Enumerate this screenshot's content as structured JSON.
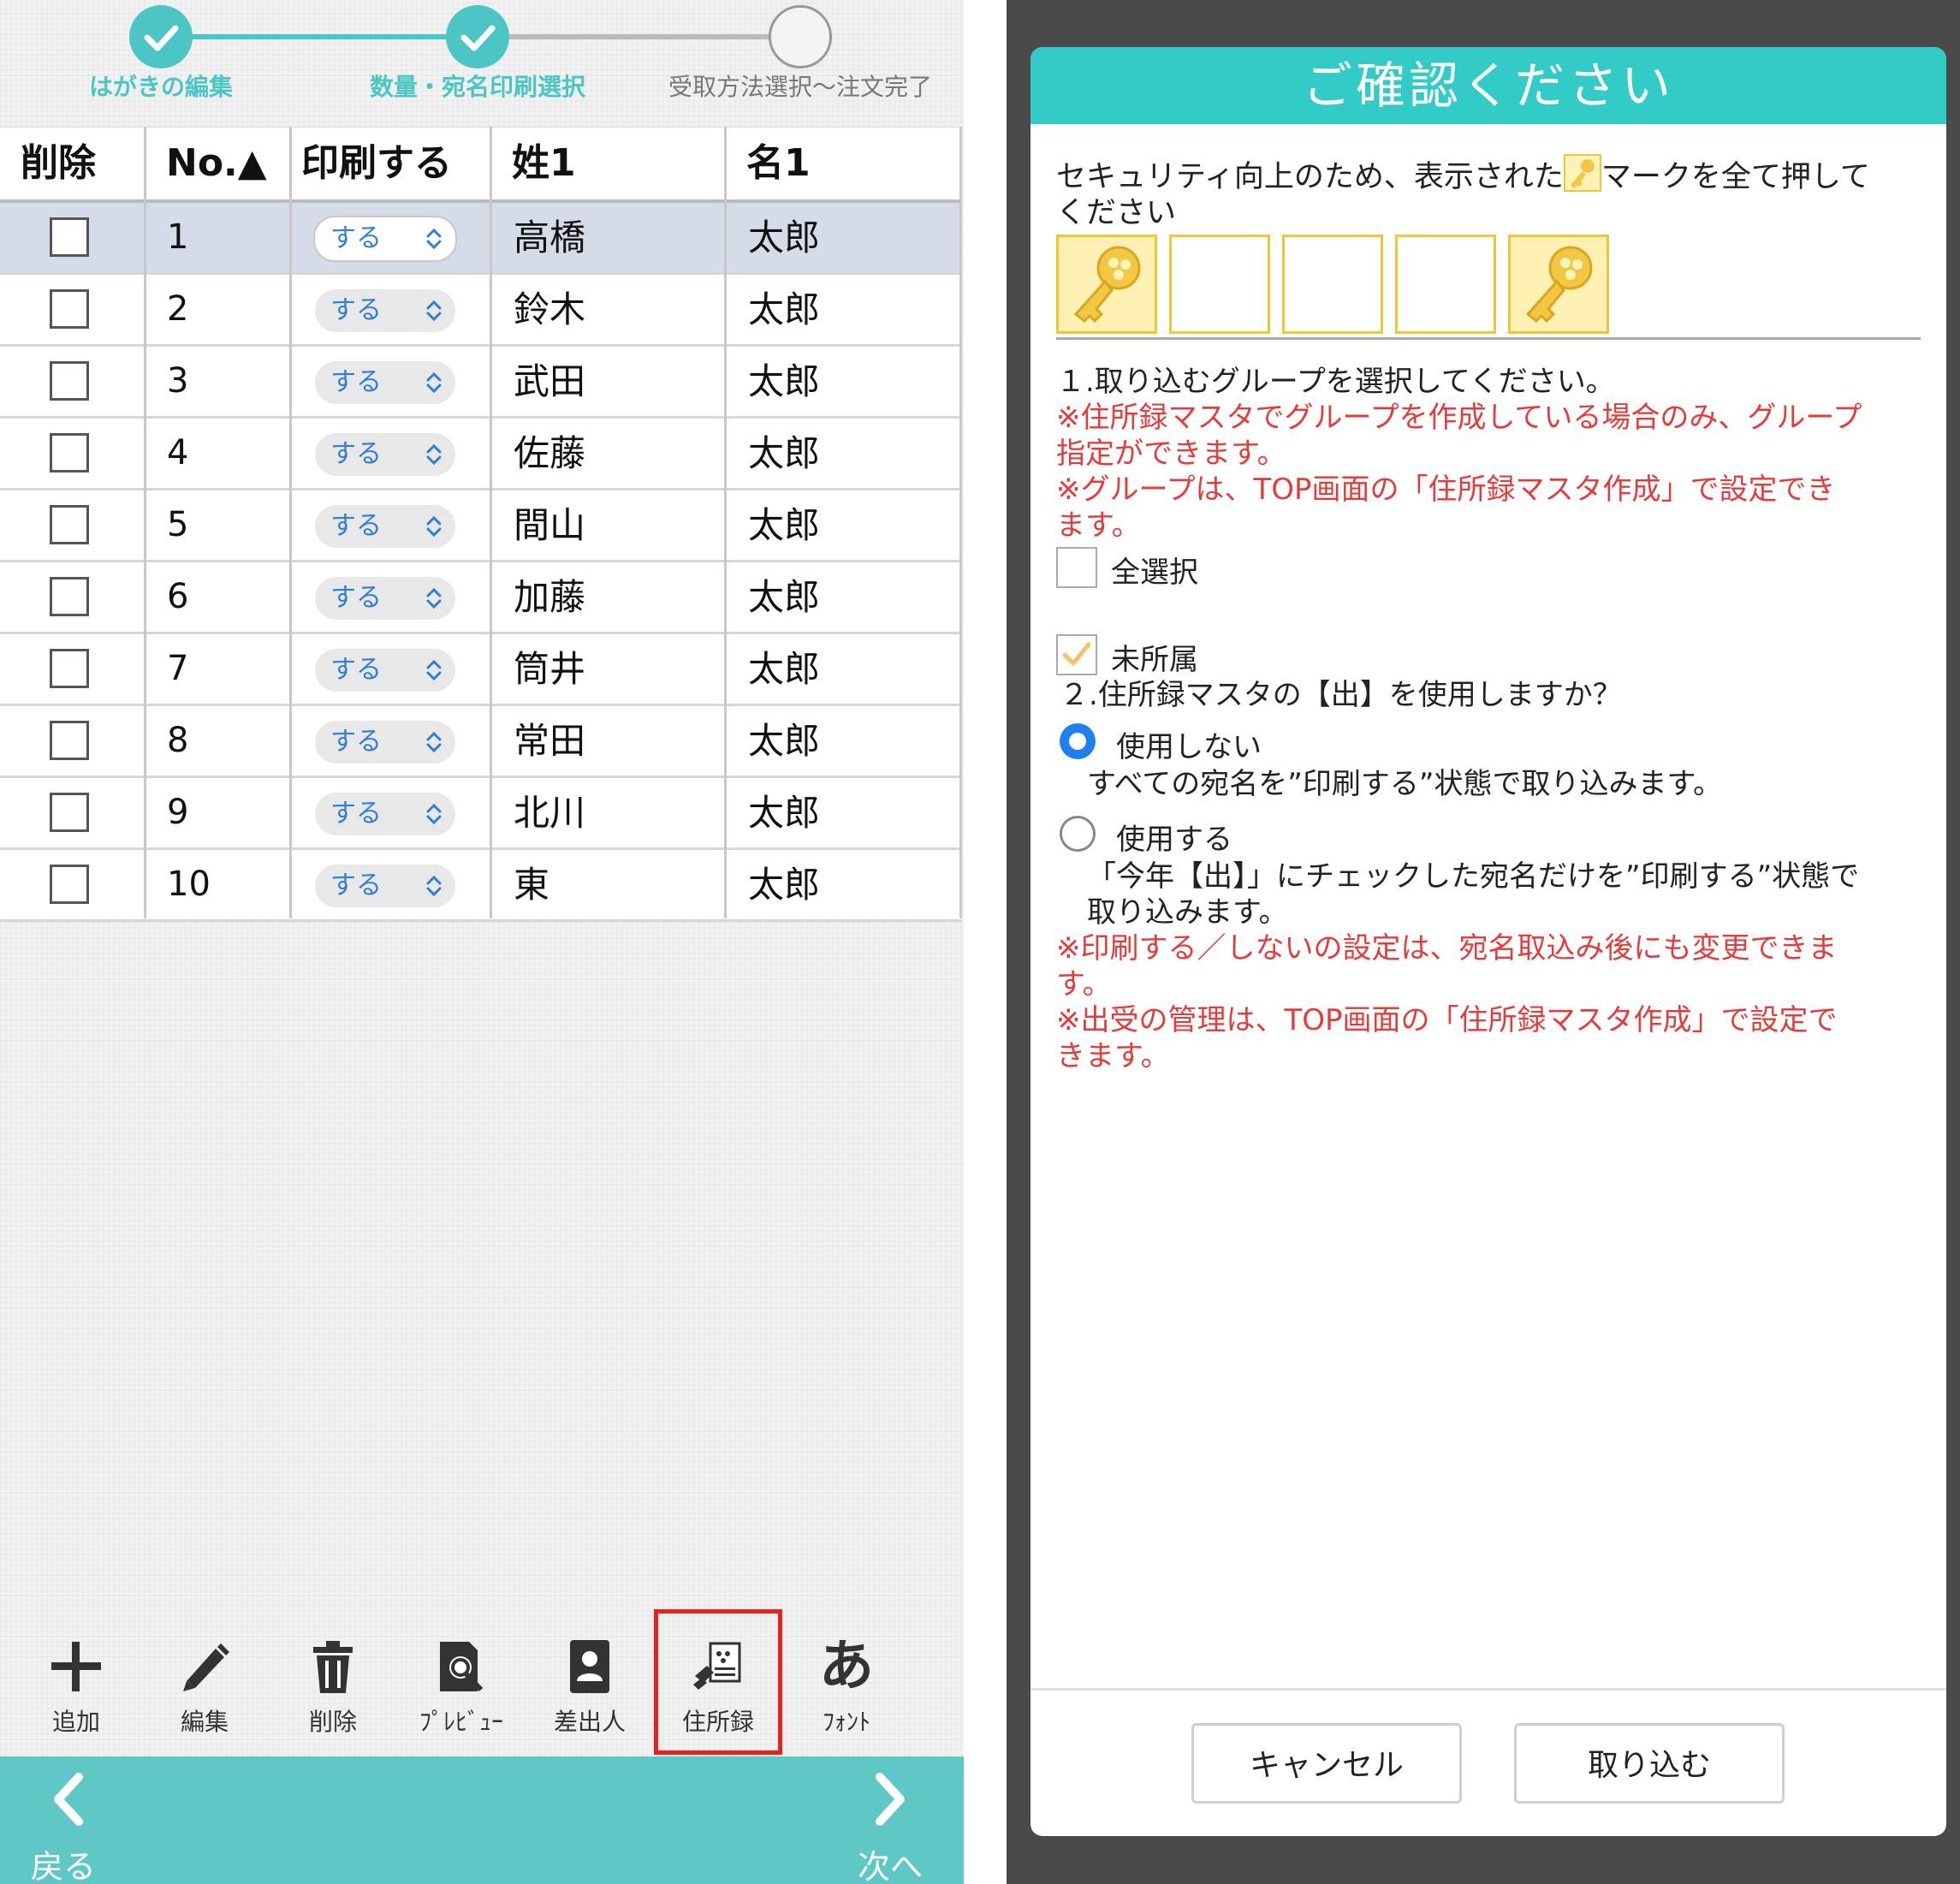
{
  "progress": {
    "steps": [
      {
        "label": "はがきの編集",
        "state": "done"
      },
      {
        "label": "数量・宛名印刷選択",
        "state": "done"
      },
      {
        "label": "受取方法選択〜注文完了",
        "state": "todo"
      }
    ]
  },
  "table": {
    "headers": {
      "delete": "削除",
      "no": "No.▲",
      "print": "印刷する",
      "sei": "姓1",
      "mei": "名1"
    },
    "rows": [
      {
        "no": "1",
        "print": "する",
        "sei": "高橋",
        "mei": "太郎"
      },
      {
        "no": "2",
        "print": "する",
        "sei": "鈴木",
        "mei": "太郎"
      },
      {
        "no": "3",
        "print": "する",
        "sei": "武田",
        "mei": "太郎"
      },
      {
        "no": "4",
        "print": "する",
        "sei": "佐藤",
        "mei": "太郎"
      },
      {
        "no": "5",
        "print": "する",
        "sei": "間山",
        "mei": "太郎"
      },
      {
        "no": "6",
        "print": "する",
        "sei": "加藤",
        "mei": "太郎"
      },
      {
        "no": "7",
        "print": "する",
        "sei": "筒井",
        "mei": "太郎"
      },
      {
        "no": "8",
        "print": "する",
        "sei": "常田",
        "mei": "太郎"
      },
      {
        "no": "9",
        "print": "する",
        "sei": "北川",
        "mei": "太郎"
      },
      {
        "no": "10",
        "print": "する",
        "sei": "東",
        "mei": "太郎"
      }
    ]
  },
  "toolbar": {
    "add": "追加",
    "edit": "編集",
    "delete": "削除",
    "preview": "ﾌﾟﾚﾋﾞｭｰ",
    "sender": "差出人",
    "address_book": "住所録",
    "font": "ﾌｫﾝﾄ",
    "font_glyph": "あ"
  },
  "footer": {
    "back": "戻る",
    "next": "次へ"
  },
  "modal": {
    "title": "ご確認ください",
    "security_before": "セキュリティ向上のため、表示された",
    "security_after": "マークを全て押して",
    "security_line2": "ください",
    "key_boxes": [
      true,
      false,
      false,
      false,
      true
    ],
    "q1": "１.取り込むグループを選択してください。",
    "note1a": "※住所録マスタでグループを作成している場合のみ、グループ",
    "note1b": "指定ができます。",
    "note2a": "※グループは、TOP画面の「住所録マスタ作成」で設定でき",
    "note2b": "ます。",
    "select_all": "全選択",
    "unassigned": "未所属",
    "q2": "２.住所録マスタの【出】を使用しますか？",
    "opt_no": "使用しない",
    "opt_no_desc": "すべての宛名を”印刷する”状態で取り込みます。",
    "opt_yes": "使用する",
    "opt_yes_desc1": "「今年【出】」にチェックした宛名だけを”印刷する”状態で",
    "opt_yes_desc2": "取り込みます。",
    "note3a": "※印刷する／しないの設定は、宛名取込み後にも変更できま",
    "note3b": "す。",
    "note4a": "※出受の管理は、TOP画面の「住所録マスタ作成」で設定で",
    "note4b": "きます。",
    "cancel": "キャンセル",
    "import": "取り込む"
  },
  "colors": {
    "accent": "#4cc6c4",
    "modal_header": "#33cbc8",
    "warning_red": "#e23c3c",
    "radio_blue": "#1e7ff0",
    "highlight_red": "#e52222"
  }
}
